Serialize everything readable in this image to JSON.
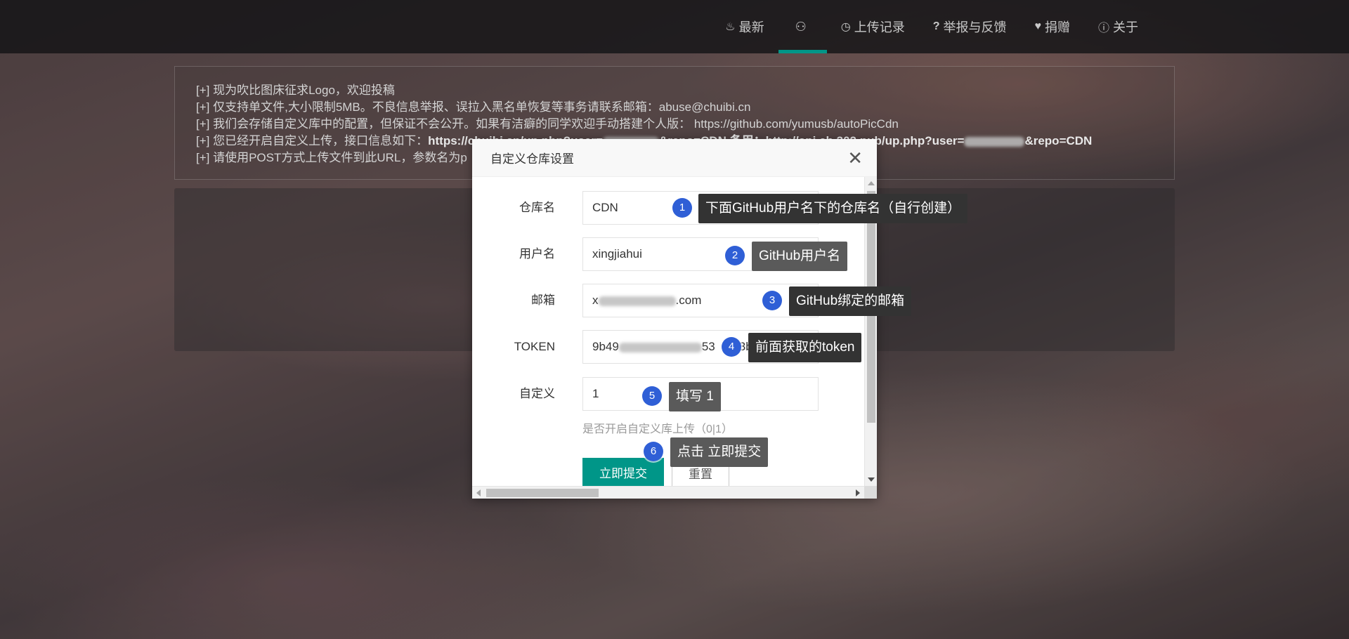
{
  "nav": {
    "items": [
      {
        "icon": "flame-icon",
        "glyph": "♨",
        "label": "最新"
      },
      {
        "icon": "user-icon",
        "glyph": "⚇",
        "label": ""
      },
      {
        "icon": "clock-icon",
        "glyph": "◷",
        "label": "上传记录"
      },
      {
        "icon": "question-icon",
        "glyph": "?",
        "label": "举报与反馈"
      },
      {
        "icon": "heart-icon",
        "glyph": "♥",
        "label": "捐赠"
      },
      {
        "icon": "info-icon",
        "glyph": "ⓘ",
        "label": "关于"
      }
    ],
    "active_index": 1,
    "accent": "#009688"
  },
  "notice": {
    "line1": "[+] 现为吹比图床征求Logo，欢迎投稿",
    "line2": "[+] 仅支持单文件,大小限制5MB。不良信息举报、误拉入黑名单恢复等事务请联系邮箱：abuse@chuibi.cn",
    "line3": "[+] 我们会存储自定义库中的配置，但保证不会公开。如果有洁癖的同学欢迎手动搭建个人版： https://github.com/yumusb/autoPicCdn",
    "line4_prefix": "[+] 您已经开启自定义上传，接口信息如下：",
    "line4_url1_a": "https://chuibi.cn/up.php?user=",
    "line4_url1_b": "&repo=CDN 备用：http://api.cb.302.pub/up.php?user=",
    "line4_url1_c": "&repo=CDN",
    "line5": "[+] 请使用POST方式上传文件到此URL，参数名为p"
  },
  "modal": {
    "title": "自定义仓库设置",
    "close_glyph": "✕",
    "fields": {
      "repo": {
        "label": "仓库名",
        "value": "CDN"
      },
      "user": {
        "label": "用户名",
        "value": "xingjiahui"
      },
      "email": {
        "label": "邮箱",
        "value_prefix": "x",
        "value_suffix": "com"
      },
      "token": {
        "label": "TOKEN",
        "value_prefix": "9b49",
        "value_mid": "53",
        "value_suffix": "3b"
      },
      "custom": {
        "label": "自定义",
        "value": "1"
      }
    },
    "hint": "是否开启自定义库上传（0|1）",
    "submit_label": "立即提交",
    "reset_label": "重置"
  },
  "annotations": [
    {
      "num": "1",
      "text": "下面GitHub用户名下的仓库名（自行创建）"
    },
    {
      "num": "2",
      "text": "GitHub用户名"
    },
    {
      "num": "3",
      "text": "GitHub绑定的邮箱"
    },
    {
      "num": "4",
      "text": "前面获取的token"
    },
    {
      "num": "5",
      "text": "填写 1"
    },
    {
      "num": "6",
      "text": "点击 立即提交"
    }
  ]
}
